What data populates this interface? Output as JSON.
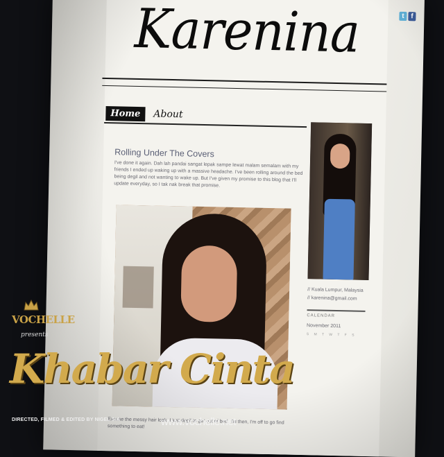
{
  "blog": {
    "logo": "Karenina",
    "social": {
      "twitter_glyph": "t",
      "facebook_glyph": "f"
    },
    "nav": {
      "home": "Home",
      "about": "About"
    },
    "post": {
      "title": "Rolling Under The Covers",
      "body": "I've done it again. Dah lah pandai sangat lepak sampe lewat malam semalam with my friends I ended up waking up with a massive headache. I've been rolling around the bed being degil and not wanting to wake up. But I've given my promise to this blog that I'll update everyday, so I tak nak break that promise.",
      "caption": "Excuse the messy hair look. I just degil to get out of bed. Till then, I'm off to go find something to eat!"
    },
    "sidebar": {
      "location": "// Kuala Lumpur, Malaysia",
      "email": "// karenina@gmail.com",
      "calendar_heading": "CALENDAR",
      "calendar_month": "November 2011",
      "weekdays": "S M T W T F S"
    }
  },
  "overlay": {
    "brand": "VOCHELLE",
    "presents": "presents",
    "show_title": "Khabar Cinta",
    "credits": "DIRECTED, FILMED & EDITED BY NIGEL SIA",
    "url": "www.vochelle.net",
    "gold": "#d2aa4d"
  }
}
